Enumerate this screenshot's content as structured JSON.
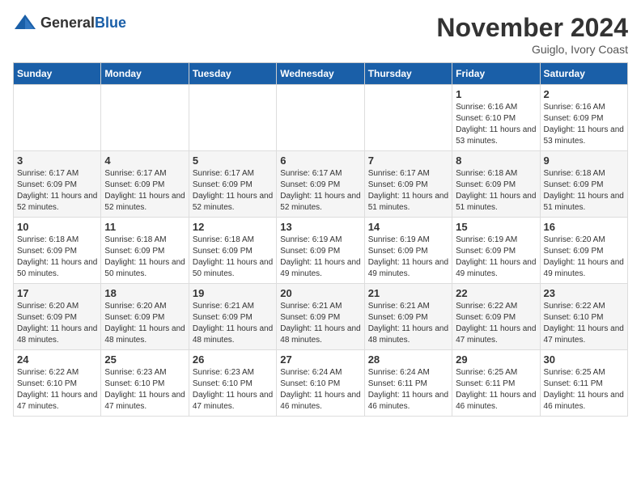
{
  "logo": {
    "general": "General",
    "blue": "Blue"
  },
  "title": "November 2024",
  "location": "Guiglo, Ivory Coast",
  "days_of_week": [
    "Sunday",
    "Monday",
    "Tuesday",
    "Wednesday",
    "Thursday",
    "Friday",
    "Saturday"
  ],
  "weeks": [
    [
      {
        "day": "",
        "sunrise": "",
        "sunset": "",
        "daylight": ""
      },
      {
        "day": "",
        "sunrise": "",
        "sunset": "",
        "daylight": ""
      },
      {
        "day": "",
        "sunrise": "",
        "sunset": "",
        "daylight": ""
      },
      {
        "day": "",
        "sunrise": "",
        "sunset": "",
        "daylight": ""
      },
      {
        "day": "",
        "sunrise": "",
        "sunset": "",
        "daylight": ""
      },
      {
        "day": "1",
        "sunrise": "Sunrise: 6:16 AM",
        "sunset": "Sunset: 6:10 PM",
        "daylight": "Daylight: 11 hours and 53 minutes."
      },
      {
        "day": "2",
        "sunrise": "Sunrise: 6:16 AM",
        "sunset": "Sunset: 6:09 PM",
        "daylight": "Daylight: 11 hours and 53 minutes."
      }
    ],
    [
      {
        "day": "3",
        "sunrise": "Sunrise: 6:17 AM",
        "sunset": "Sunset: 6:09 PM",
        "daylight": "Daylight: 11 hours and 52 minutes."
      },
      {
        "day": "4",
        "sunrise": "Sunrise: 6:17 AM",
        "sunset": "Sunset: 6:09 PM",
        "daylight": "Daylight: 11 hours and 52 minutes."
      },
      {
        "day": "5",
        "sunrise": "Sunrise: 6:17 AM",
        "sunset": "Sunset: 6:09 PM",
        "daylight": "Daylight: 11 hours and 52 minutes."
      },
      {
        "day": "6",
        "sunrise": "Sunrise: 6:17 AM",
        "sunset": "Sunset: 6:09 PM",
        "daylight": "Daylight: 11 hours and 52 minutes."
      },
      {
        "day": "7",
        "sunrise": "Sunrise: 6:17 AM",
        "sunset": "Sunset: 6:09 PM",
        "daylight": "Daylight: 11 hours and 51 minutes."
      },
      {
        "day": "8",
        "sunrise": "Sunrise: 6:18 AM",
        "sunset": "Sunset: 6:09 PM",
        "daylight": "Daylight: 11 hours and 51 minutes."
      },
      {
        "day": "9",
        "sunrise": "Sunrise: 6:18 AM",
        "sunset": "Sunset: 6:09 PM",
        "daylight": "Daylight: 11 hours and 51 minutes."
      }
    ],
    [
      {
        "day": "10",
        "sunrise": "Sunrise: 6:18 AM",
        "sunset": "Sunset: 6:09 PM",
        "daylight": "Daylight: 11 hours and 50 minutes."
      },
      {
        "day": "11",
        "sunrise": "Sunrise: 6:18 AM",
        "sunset": "Sunset: 6:09 PM",
        "daylight": "Daylight: 11 hours and 50 minutes."
      },
      {
        "day": "12",
        "sunrise": "Sunrise: 6:18 AM",
        "sunset": "Sunset: 6:09 PM",
        "daylight": "Daylight: 11 hours and 50 minutes."
      },
      {
        "day": "13",
        "sunrise": "Sunrise: 6:19 AM",
        "sunset": "Sunset: 6:09 PM",
        "daylight": "Daylight: 11 hours and 49 minutes."
      },
      {
        "day": "14",
        "sunrise": "Sunrise: 6:19 AM",
        "sunset": "Sunset: 6:09 PM",
        "daylight": "Daylight: 11 hours and 49 minutes."
      },
      {
        "day": "15",
        "sunrise": "Sunrise: 6:19 AM",
        "sunset": "Sunset: 6:09 PM",
        "daylight": "Daylight: 11 hours and 49 minutes."
      },
      {
        "day": "16",
        "sunrise": "Sunrise: 6:20 AM",
        "sunset": "Sunset: 6:09 PM",
        "daylight": "Daylight: 11 hours and 49 minutes."
      }
    ],
    [
      {
        "day": "17",
        "sunrise": "Sunrise: 6:20 AM",
        "sunset": "Sunset: 6:09 PM",
        "daylight": "Daylight: 11 hours and 48 minutes."
      },
      {
        "day": "18",
        "sunrise": "Sunrise: 6:20 AM",
        "sunset": "Sunset: 6:09 PM",
        "daylight": "Daylight: 11 hours and 48 minutes."
      },
      {
        "day": "19",
        "sunrise": "Sunrise: 6:21 AM",
        "sunset": "Sunset: 6:09 PM",
        "daylight": "Daylight: 11 hours and 48 minutes."
      },
      {
        "day": "20",
        "sunrise": "Sunrise: 6:21 AM",
        "sunset": "Sunset: 6:09 PM",
        "daylight": "Daylight: 11 hours and 48 minutes."
      },
      {
        "day": "21",
        "sunrise": "Sunrise: 6:21 AM",
        "sunset": "Sunset: 6:09 PM",
        "daylight": "Daylight: 11 hours and 48 minutes."
      },
      {
        "day": "22",
        "sunrise": "Sunrise: 6:22 AM",
        "sunset": "Sunset: 6:09 PM",
        "daylight": "Daylight: 11 hours and 47 minutes."
      },
      {
        "day": "23",
        "sunrise": "Sunrise: 6:22 AM",
        "sunset": "Sunset: 6:10 PM",
        "daylight": "Daylight: 11 hours and 47 minutes."
      }
    ],
    [
      {
        "day": "24",
        "sunrise": "Sunrise: 6:22 AM",
        "sunset": "Sunset: 6:10 PM",
        "daylight": "Daylight: 11 hours and 47 minutes."
      },
      {
        "day": "25",
        "sunrise": "Sunrise: 6:23 AM",
        "sunset": "Sunset: 6:10 PM",
        "daylight": "Daylight: 11 hours and 47 minutes."
      },
      {
        "day": "26",
        "sunrise": "Sunrise: 6:23 AM",
        "sunset": "Sunset: 6:10 PM",
        "daylight": "Daylight: 11 hours and 47 minutes."
      },
      {
        "day": "27",
        "sunrise": "Sunrise: 6:24 AM",
        "sunset": "Sunset: 6:10 PM",
        "daylight": "Daylight: 11 hours and 46 minutes."
      },
      {
        "day": "28",
        "sunrise": "Sunrise: 6:24 AM",
        "sunset": "Sunset: 6:11 PM",
        "daylight": "Daylight: 11 hours and 46 minutes."
      },
      {
        "day": "29",
        "sunrise": "Sunrise: 6:25 AM",
        "sunset": "Sunset: 6:11 PM",
        "daylight": "Daylight: 11 hours and 46 minutes."
      },
      {
        "day": "30",
        "sunrise": "Sunrise: 6:25 AM",
        "sunset": "Sunset: 6:11 PM",
        "daylight": "Daylight: 11 hours and 46 minutes."
      }
    ]
  ]
}
